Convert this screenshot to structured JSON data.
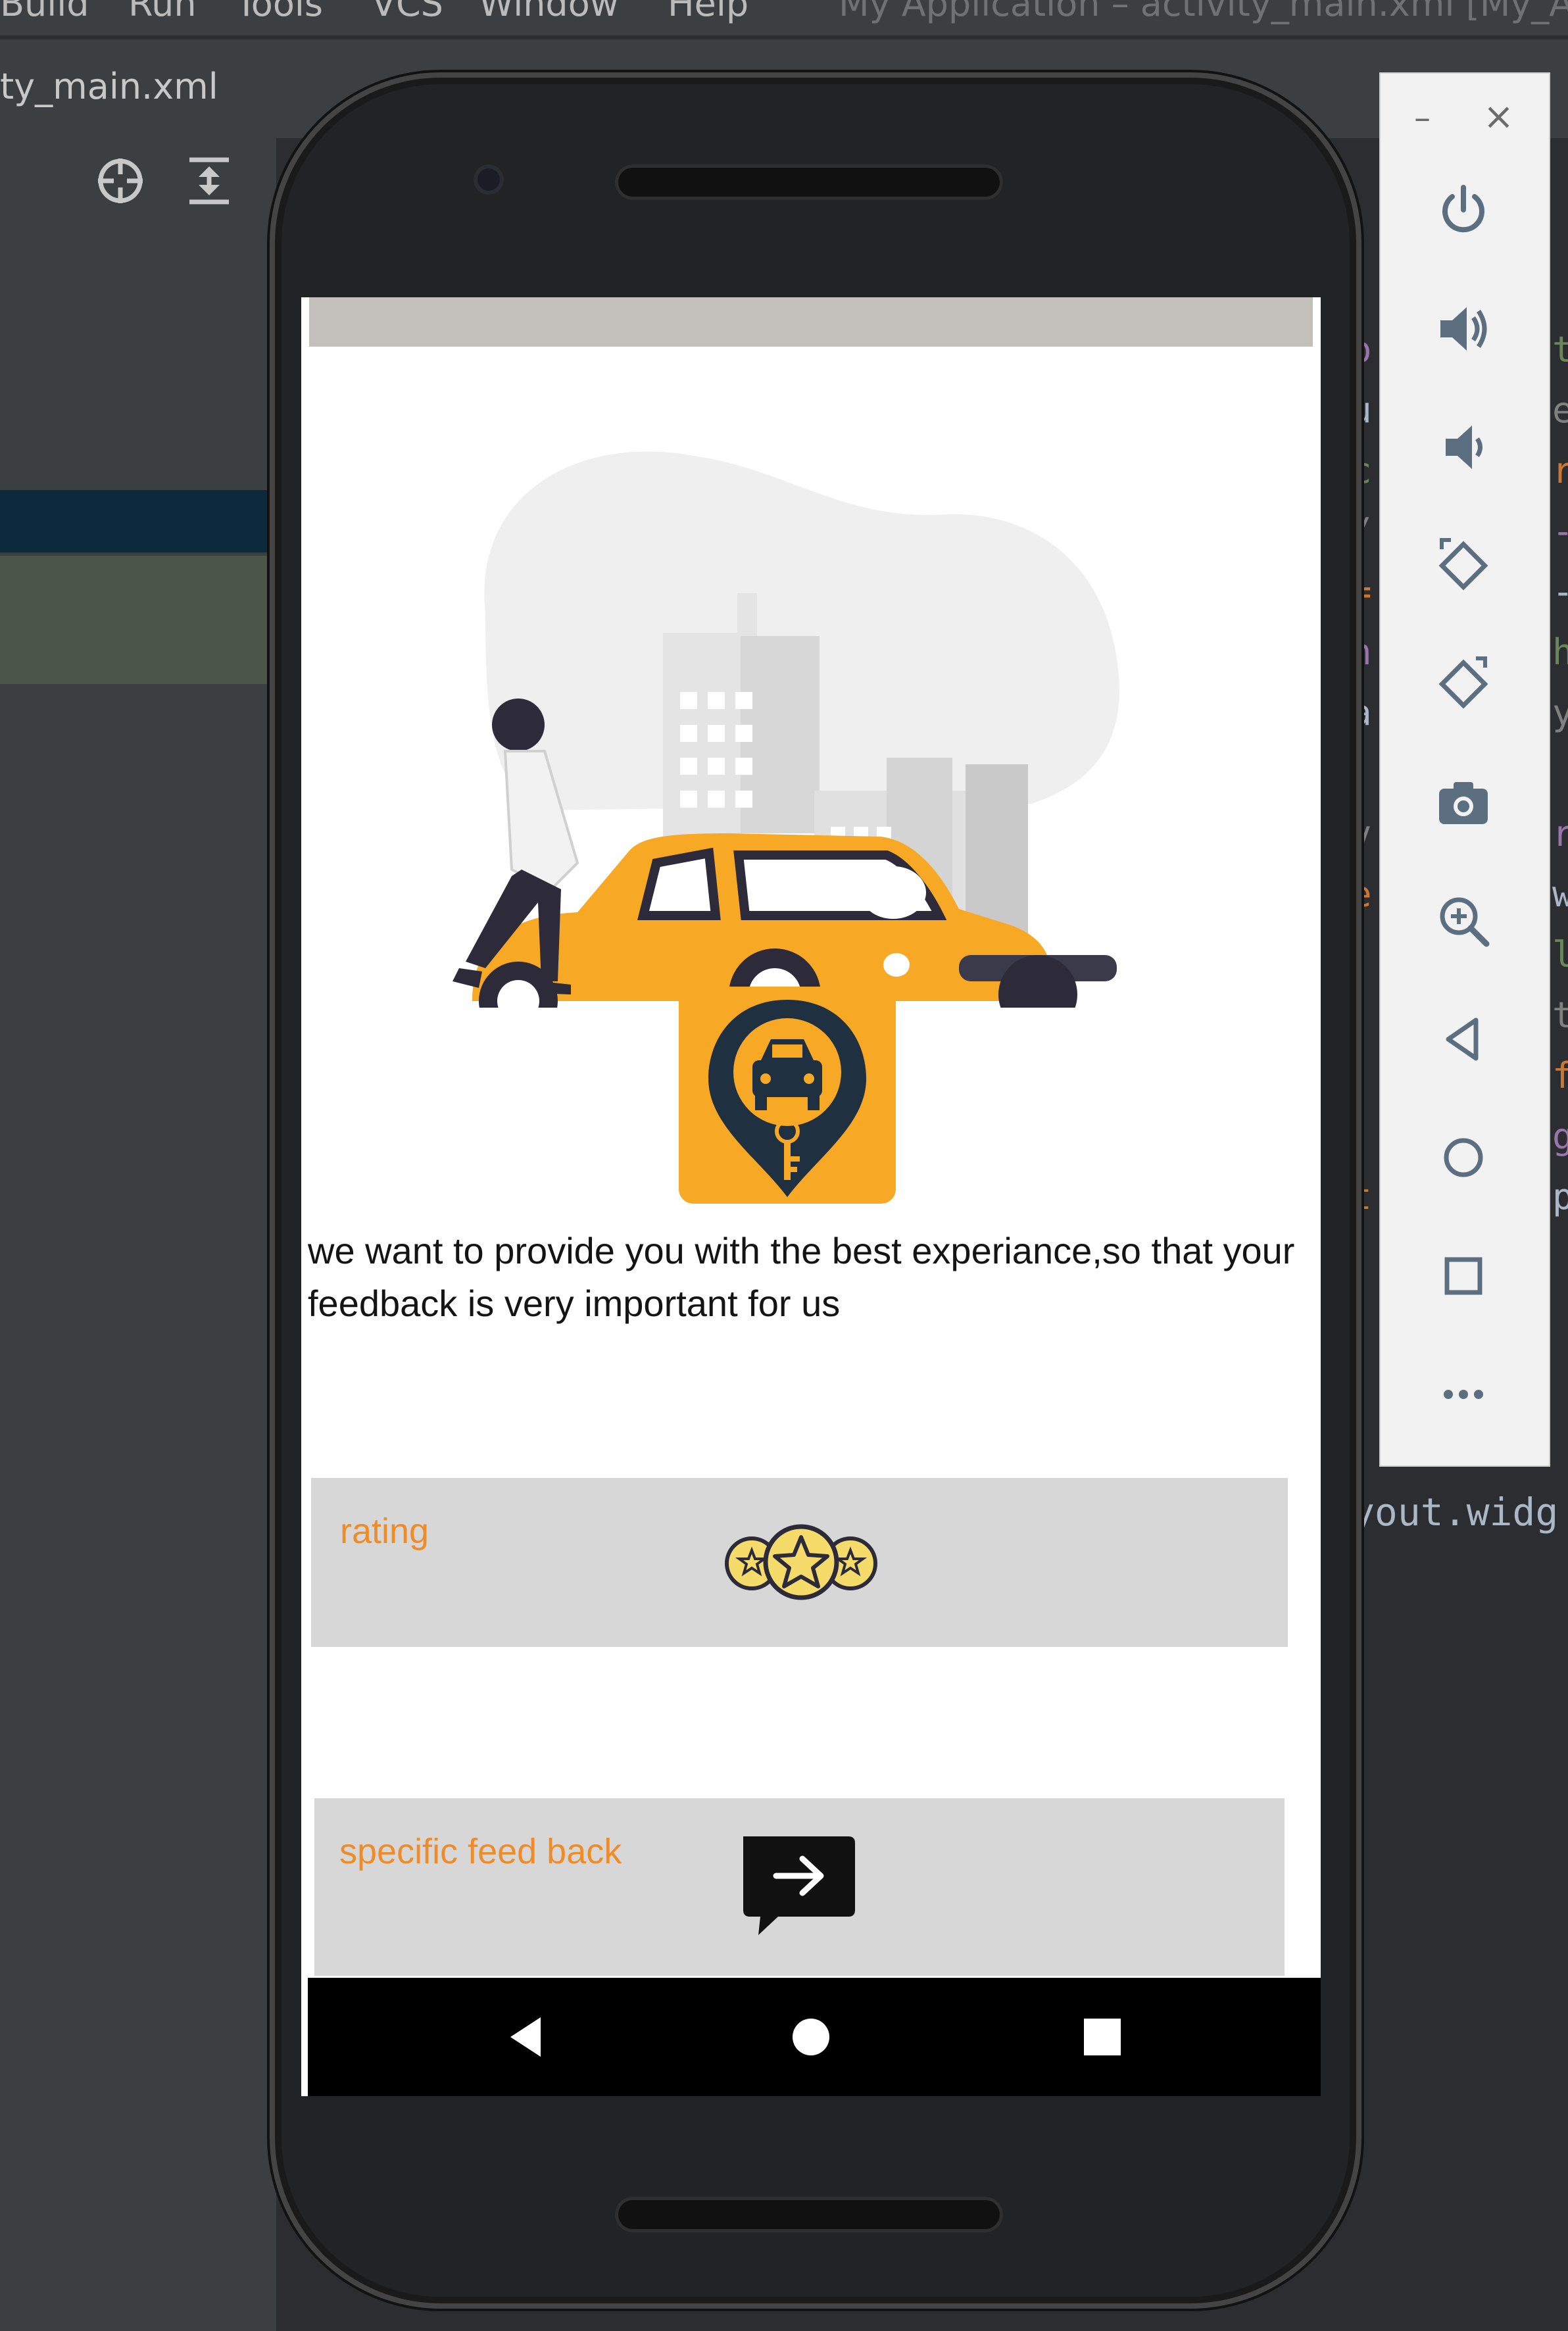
{
  "ide": {
    "menu": [
      "Build",
      "Run",
      "Tools",
      "VCS",
      "Window",
      "Help"
    ],
    "window_title": "My Application – activity_main.xml [My_A",
    "file_tab": "ty_main.xml",
    "code_tail": "yout.widg",
    "code_fragments_left": [
      "o",
      "u",
      "c",
      "/",
      "=",
      "n",
      "a",
      "",
      "v",
      "e",
      "",
      "",
      "",
      "",
      "t"
    ],
    "code_fragments_right": [
      "t",
      "e",
      "r",
      "-",
      "-",
      "h",
      "y",
      "",
      "r",
      "w",
      "l",
      "t",
      "f",
      "g",
      "p"
    ]
  },
  "emulator_panel": {
    "minimize_label": "–",
    "close_label": "×",
    "controls": [
      "power-icon",
      "volume-up-icon",
      "volume-down-icon",
      "rotate-left-icon",
      "rotate-right-icon",
      "camera-icon",
      "zoom-icon",
      "back-icon",
      "home-icon",
      "overview-icon",
      "more-icon"
    ]
  },
  "app": {
    "description": "we want to provide you with the best  experiance,so that your feedback is very important for us",
    "rating_label": "rating",
    "feedback_label": "specific feed back"
  },
  "colors": {
    "accent_orange": "#f7a824",
    "label_orange": "#ef8c2a",
    "card_gray": "#d7d7d7",
    "status_bar": "#c3c0bb"
  }
}
